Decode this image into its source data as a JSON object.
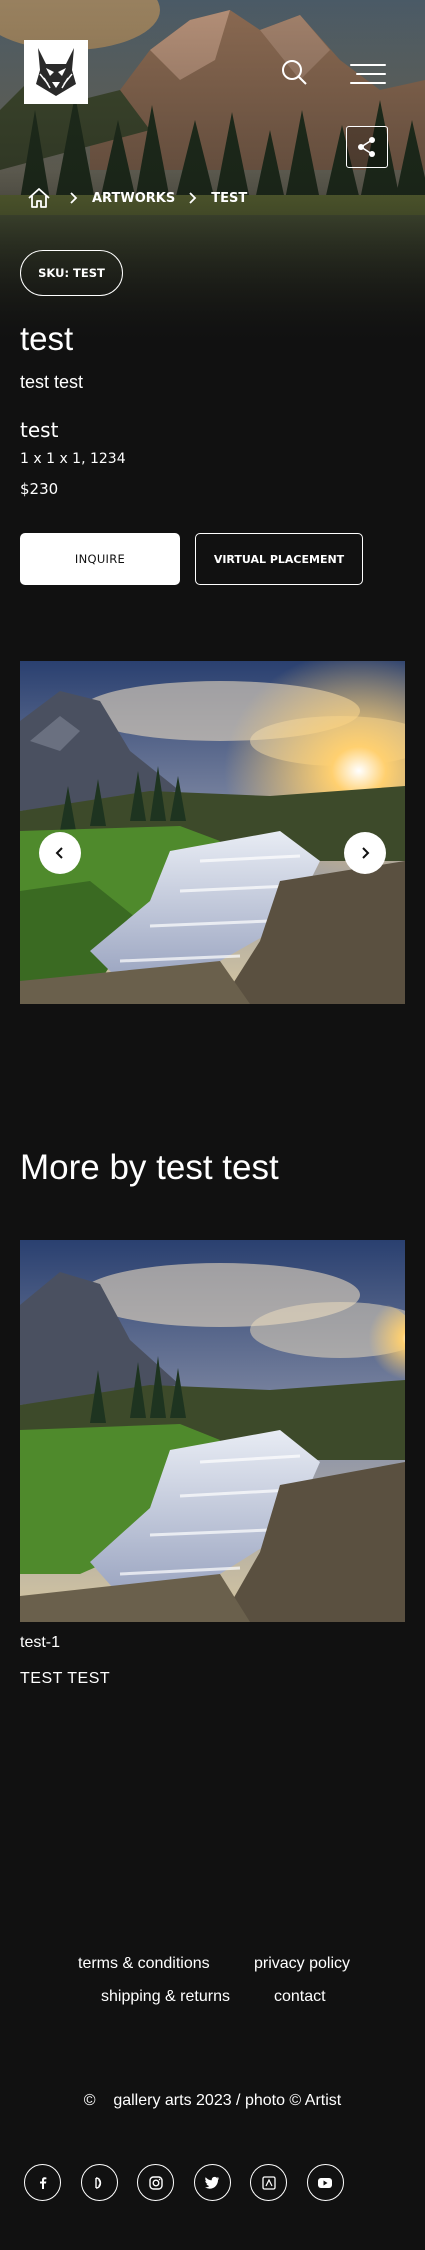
{
  "header": {
    "logo_alt": "lynx-logo",
    "search_icon": "search-icon",
    "menu_icon": "hamburger-menu-icon",
    "share_icon": "share-icon"
  },
  "breadcrumb": {
    "home_icon": "home-icon",
    "items": [
      "ARTWORKS",
      "TEST"
    ]
  },
  "artwork": {
    "sku": "SKU: TEST",
    "title": "test",
    "artist": "test test",
    "name": "test",
    "dimensions": "1 x 1 x 1, 1234",
    "price": "$230"
  },
  "actions": {
    "inquire": "INQUIRE",
    "virtual_placement": "VIRTUAL PLACEMENT"
  },
  "gallery": {
    "prev_icon": "chevron-left-icon",
    "next_icon": "chevron-right-icon"
  },
  "more": {
    "heading": "More by test test",
    "items": [
      {
        "name": "test-1",
        "artist": "TEST  TEST"
      }
    ]
  },
  "footer": {
    "links": [
      "terms & conditions",
      "privacy policy",
      "shipping & returns",
      "contact"
    ],
    "copyright": "©    gallery arts 2023 / photo © Artist",
    "socials": [
      "facebook-icon",
      "deviantart-icon",
      "instagram-icon",
      "twitter-icon",
      "artstation-icon",
      "youtube-icon"
    ]
  },
  "colors": {
    "background": "#111111",
    "text": "#ffffff"
  }
}
